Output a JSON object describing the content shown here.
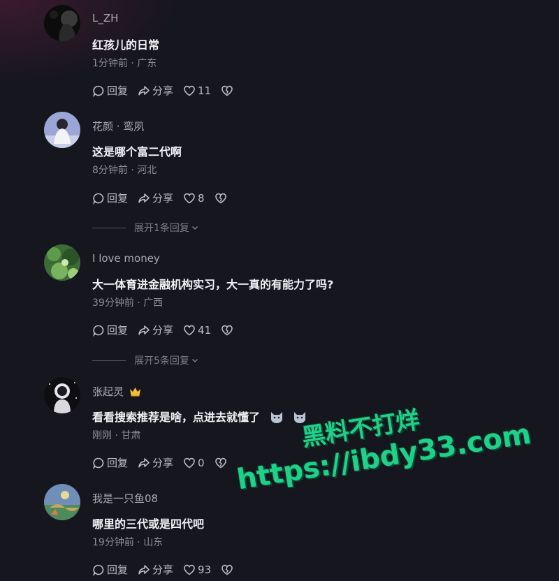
{
  "comments": [
    {
      "username": "L_ZH",
      "text": "红孩儿的日常",
      "time": "1分钟前",
      "location": "广东",
      "reply_label": "回复",
      "share_label": "分享",
      "likes": "11"
    },
    {
      "username": "花颜 · 鸾夙",
      "text": "这是哪个富二代啊",
      "time": "8分钟前",
      "location": "河北",
      "reply_label": "回复",
      "share_label": "分享",
      "likes": "8",
      "expand_label": "展开1条回复"
    },
    {
      "username": "I love money",
      "text": "大一体育进金融机构实习，大一真的有能力了吗?",
      "time": "39分钟前",
      "location": "广西",
      "reply_label": "回复",
      "share_label": "分享",
      "likes": "41",
      "expand_label": "展开5条回复"
    },
    {
      "username": "张起灵",
      "text": "看看搜索推荐是啥，点进去就懂了",
      "time": "刚刚",
      "location": "甘肃",
      "reply_label": "回复",
      "share_label": "分享",
      "likes": "0"
    },
    {
      "username": "我是一只鱼08",
      "text": "哪里的三代或是四代吧",
      "time": "19分钟前",
      "location": "山东",
      "reply_label": "回复",
      "share_label": "分享",
      "likes": "93"
    }
  ],
  "meta_separator": "·",
  "watermark": {
    "line1": "黑料不打烊",
    "line2": "https://ibdy33.com"
  },
  "icons": [
    "reply-bubble-icon",
    "share-arrow-icon",
    "heart-outline-icon",
    "broken-heart-icon",
    "chevron-down-icon",
    "crown-icon",
    "cat-emoji-icon"
  ],
  "colors": {
    "background": "#16161e",
    "username": "#a9a9b3",
    "meta": "#8d8d97",
    "watermark": "#1fd08a"
  }
}
